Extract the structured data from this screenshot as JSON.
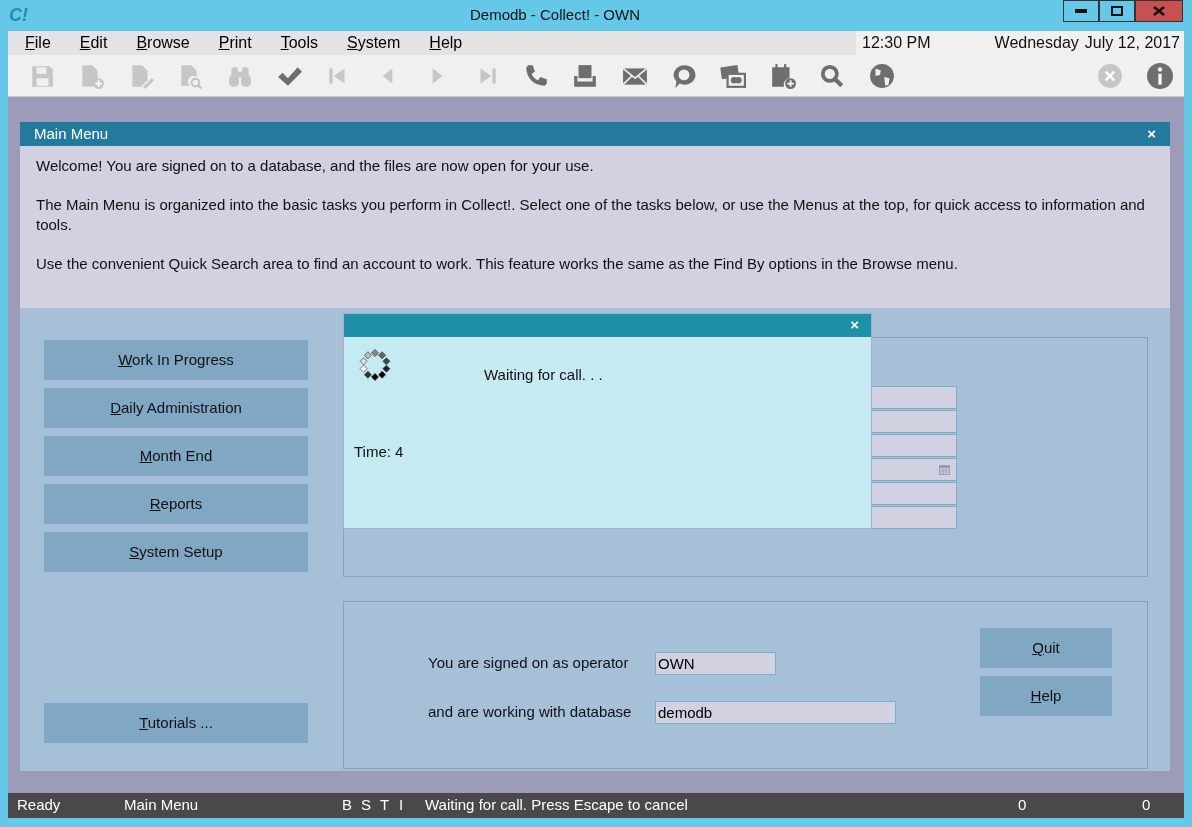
{
  "window": {
    "title": "Demodb - Collect! - OWN",
    "logo": "C!"
  },
  "menu": [
    {
      "label": "File"
    },
    {
      "label": "Edit"
    },
    {
      "label": "Browse"
    },
    {
      "label": "Print"
    },
    {
      "label": "Tools"
    },
    {
      "label": "System"
    },
    {
      "label": "Help"
    }
  ],
  "clock": {
    "time": "12:30 PM",
    "day": "Wednesday",
    "date": "July 12, 2017"
  },
  "toolbar": [
    {
      "kind": "save",
      "disabled": true
    },
    {
      "kind": "new",
      "disabled": true
    },
    {
      "kind": "edit",
      "disabled": true
    },
    {
      "kind": "preview",
      "disabled": true
    },
    {
      "kind": "binoculars",
      "disabled": true
    },
    {
      "kind": "check",
      "disabled": false
    },
    {
      "kind": "first",
      "disabled": true
    },
    {
      "kind": "prev",
      "disabled": true
    },
    {
      "kind": "next",
      "disabled": true
    },
    {
      "kind": "last",
      "disabled": true
    },
    {
      "kind": "phone",
      "disabled": false
    },
    {
      "kind": "printer",
      "disabled": false
    },
    {
      "kind": "mail",
      "disabled": false
    },
    {
      "kind": "chat",
      "disabled": false
    },
    {
      "kind": "card",
      "disabled": false
    },
    {
      "kind": "calendar",
      "disabled": false
    },
    {
      "kind": "search",
      "disabled": false
    },
    {
      "kind": "globe",
      "disabled": false
    }
  ],
  "toolbar_right": [
    {
      "kind": "cancel",
      "disabled": true
    },
    {
      "kind": "info",
      "disabled": false
    }
  ],
  "main_menu": {
    "title": "Main Menu",
    "close": "×",
    "paragraphs": [
      "Welcome! You are signed on to a database, and the files are now open for your use.",
      "The Main Menu is organized into the basic tasks you perform in Collect!. Select one of the tasks below, or use the Menus at the top, for quick access to information and tools.",
      "Use the convenient Quick Search area to find an account to work. This feature works the same as the Find By options in the Browse menu."
    ],
    "tasks": [
      {
        "label": "Work In Progress"
      },
      {
        "label": "Daily Administration"
      },
      {
        "label": "Month End"
      },
      {
        "label": "Reports"
      },
      {
        "label": "System Setup"
      }
    ],
    "tutorials": {
      "label": "Tutorials ..."
    },
    "search_fields": [
      {
        "kind": "text"
      },
      {
        "kind": "text"
      },
      {
        "kind": "text"
      },
      {
        "kind": "date"
      },
      {
        "kind": "text"
      },
      {
        "kind": "text"
      }
    ],
    "operator_label": "You are signed on as operator",
    "operator": "OWN",
    "database_label": "and are working with database",
    "database": "demodb",
    "buttons": [
      {
        "label": "Quit"
      },
      {
        "label": "Help"
      }
    ]
  },
  "dialog": {
    "close": "×",
    "message": "Waiting for call. . .",
    "time": "Time: 4"
  },
  "status_bar": {
    "state": "Ready",
    "screen": "Main Menu",
    "flags": [
      "B",
      "S",
      "T",
      "I"
    ],
    "message": "Waiting for call. Press Escape to cancel",
    "count_1": "0",
    "count_2": "0"
  }
}
